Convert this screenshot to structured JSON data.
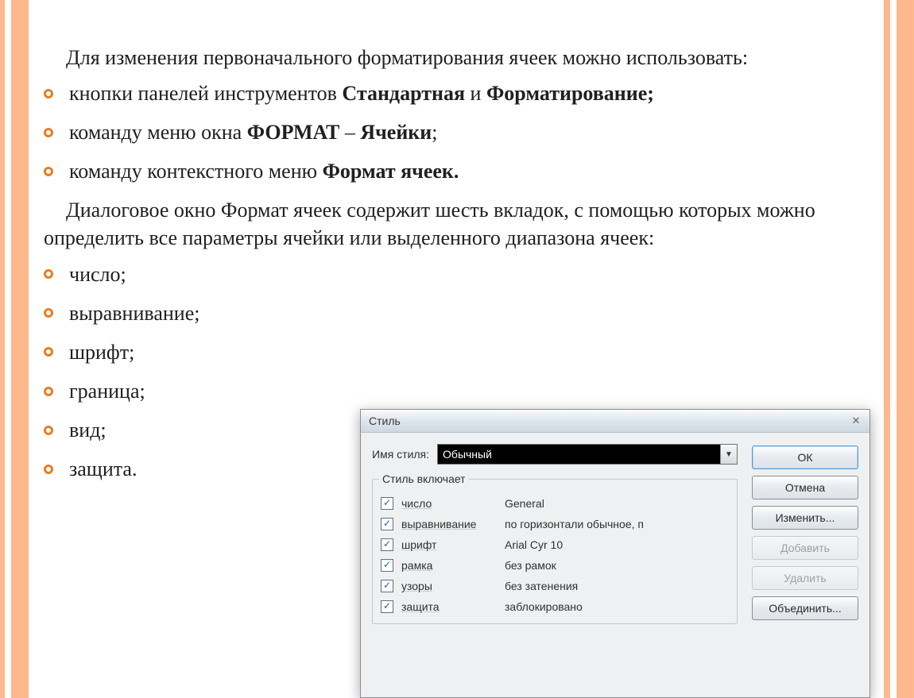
{
  "intro": "Для изменения первоначального форматирования ячеек можно использовать:",
  "li1_pre": "кнопки панелей инструментов ",
  "li1_b1": "Стандартная",
  "li1_mid": " и ",
  "li1_b2": "Форматирование;",
  "li2_pre": "команду меню окна ",
  "li2_b1": "ФОРМАТ",
  "li2_mid": " – ",
  "li2_b2": "Ячейки",
  "li2_suf": ";",
  "li3_pre": "команду контекстного меню ",
  "li3_b": "Формат ячеек.",
  "desc": "Диалоговое окно Формат ячеек содержит шесть вкладок, с помощью которых можно определить все параметры ячейки или выделенного диапазона ячеек:",
  "tabs": {
    "t1": "число;",
    "t2": "выравнивание;",
    "t3": "шрифт;",
    "t4": "граница;",
    "t5": "вид;",
    "t6": "защита."
  },
  "dialog": {
    "title": "Стиль",
    "close": "✕",
    "name_label": "Имя стиля:",
    "name_value": "Обычный",
    "group_title": "Стиль включает",
    "items": {
      "i1": {
        "label": "число",
        "value": "General"
      },
      "i2": {
        "label": "выравнивание",
        "value": "по горизонтали обычное, п"
      },
      "i3": {
        "label": "шрифт",
        "value": "Arial Cyr 10"
      },
      "i4": {
        "label": "рамка",
        "value": "без рамок"
      },
      "i5": {
        "label": "узоры",
        "value": "без затенения"
      },
      "i6": {
        "label": "защита",
        "value": "заблокировано"
      }
    },
    "buttons": {
      "ok": "ОК",
      "cancel": "Отмена",
      "modify": "Изменить...",
      "add": "Добавить",
      "delete": "Удалить",
      "merge": "Объединить..."
    }
  }
}
